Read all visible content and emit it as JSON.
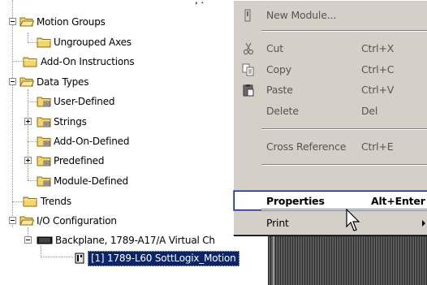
{
  "tree": {
    "top_partial_label": ", .",
    "items": [
      {
        "label": "Motion Groups"
      },
      {
        "label": "Ungrouped Axes"
      },
      {
        "label": "Add-On Instructions"
      },
      {
        "label": "Data Types"
      },
      {
        "label": "User-Defined"
      },
      {
        "label": "Strings"
      },
      {
        "label": "Add-On-Defined"
      },
      {
        "label": "Predefined"
      },
      {
        "label": "Module-Defined"
      },
      {
        "label": "Trends"
      },
      {
        "label": "I/O Configuration"
      },
      {
        "label": "Backplane, 1789-A17/A Virtual Ch"
      },
      {
        "label": "[1] 1789-L60 SottLogix_Motion"
      }
    ]
  },
  "context_menu": {
    "items": [
      {
        "label": "New Module...",
        "shortcut": "",
        "icon": "new-module-icon"
      },
      {
        "label": "Cut",
        "shortcut": "Ctrl+X",
        "icon": "scissors-icon"
      },
      {
        "label": "Copy",
        "shortcut": "Ctrl+C",
        "icon": "copy-icon"
      },
      {
        "label": "Paste",
        "shortcut": "Ctrl+V",
        "icon": "paste-icon"
      },
      {
        "label": "Delete",
        "shortcut": "Del",
        "icon": ""
      },
      {
        "label": "Cross Reference",
        "shortcut": "Ctrl+E",
        "icon": ""
      },
      {
        "label": "Properties",
        "shortcut": "Alt+Enter",
        "icon": "",
        "highlighted": true
      },
      {
        "label": "Print",
        "shortcut": "",
        "icon": "",
        "submenu": true
      }
    ]
  },
  "colors": {
    "menu_bg": "#d4d0c8",
    "selection": "#0a246a",
    "folder": "#f5d468"
  }
}
